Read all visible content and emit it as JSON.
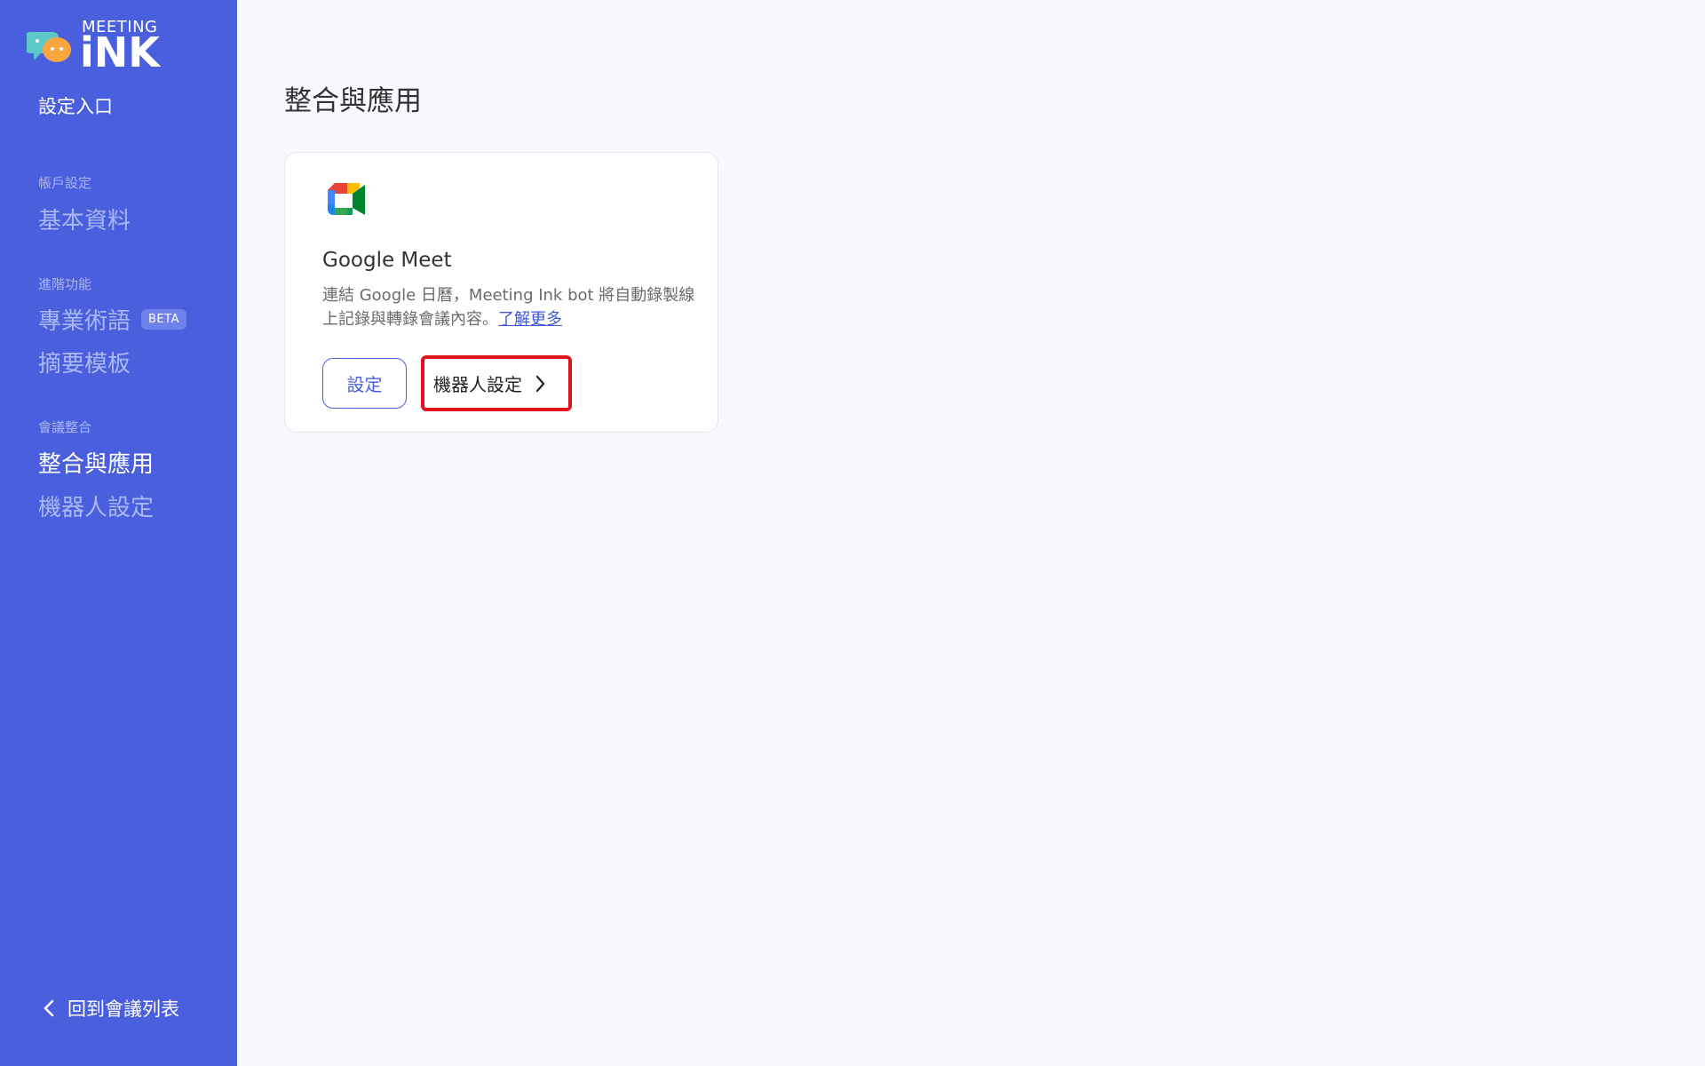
{
  "logo": {
    "top_text": "MEETING",
    "bottom_text": "iNK"
  },
  "sidebar": {
    "entry_title": "設定入口",
    "sections": [
      {
        "label": "帳戶設定",
        "items": [
          {
            "label": "基本資料",
            "active": false
          }
        ]
      },
      {
        "label": "進階功能",
        "items": [
          {
            "label": "專業術語",
            "active": false,
            "badge": "BETA"
          },
          {
            "label": "摘要模板",
            "active": false
          }
        ]
      },
      {
        "label": "會議整合",
        "items": [
          {
            "label": "整合與應用",
            "active": true
          },
          {
            "label": "機器人設定",
            "active": false
          }
        ]
      }
    ],
    "back_link": "回到會議列表"
  },
  "main": {
    "title": "整合與應用",
    "card": {
      "icon": "google-meet-icon",
      "name": "Google Meet",
      "description": "連結 Google 日曆，Meeting Ink bot 將自動錄製線上記錄與轉錄會議內容。",
      "learn_more": "了解更多",
      "setup_button": "設定",
      "bot_button": "機器人設定"
    }
  },
  "colors": {
    "sidebar_bg": "#4a5fde",
    "page_bg": "#f8f9fe",
    "accent": "#4a5fde",
    "highlight_border": "#e0141e"
  }
}
